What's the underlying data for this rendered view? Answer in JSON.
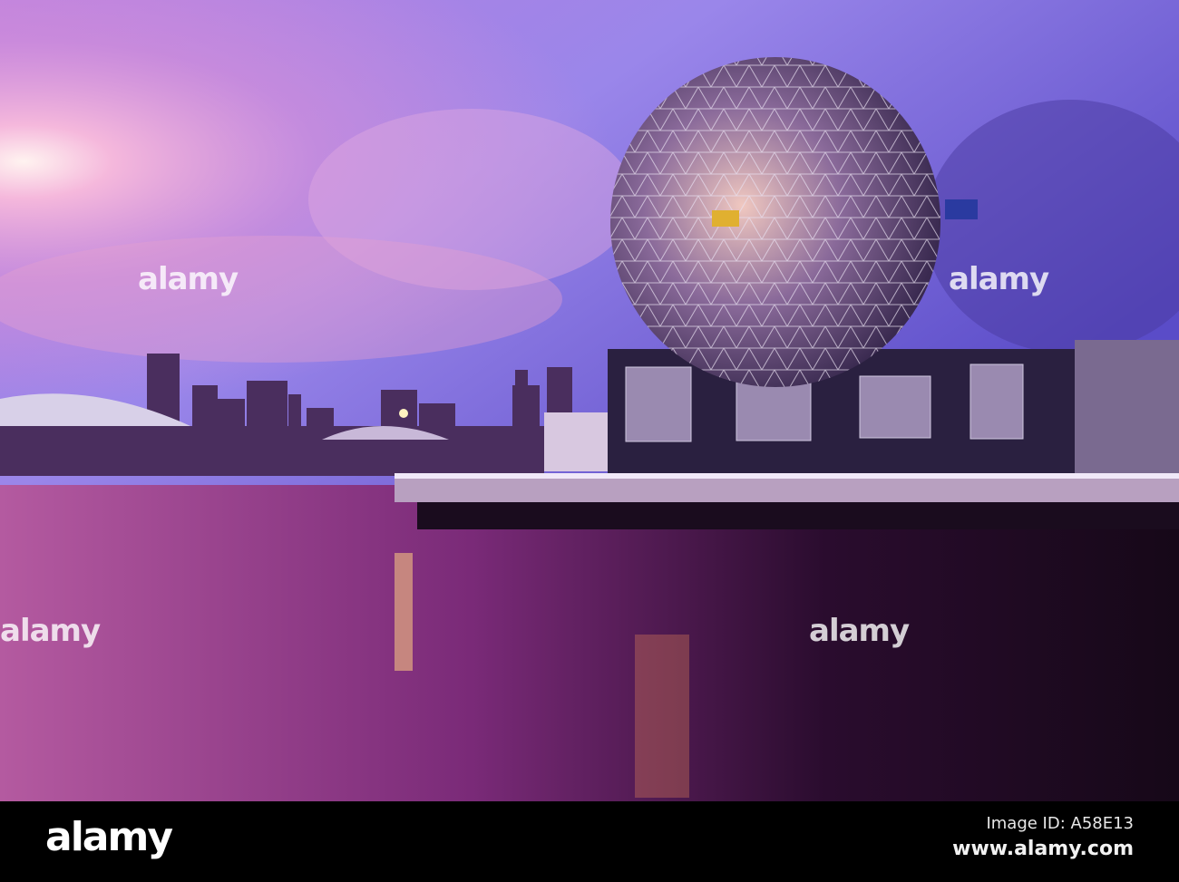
{
  "photo": {
    "subject": "Science World geodesic dome at sunset over False Creek",
    "watermark_text": "alamy"
  },
  "footer": {
    "logo": "alamy",
    "image_id": "Image ID: A58E13",
    "website": "www.alamy.com"
  },
  "colors": {
    "sky_top": "#7b6ee0",
    "sky_pink": "#e79ad8",
    "water": "#7a2f7a",
    "bar": "#000000"
  }
}
